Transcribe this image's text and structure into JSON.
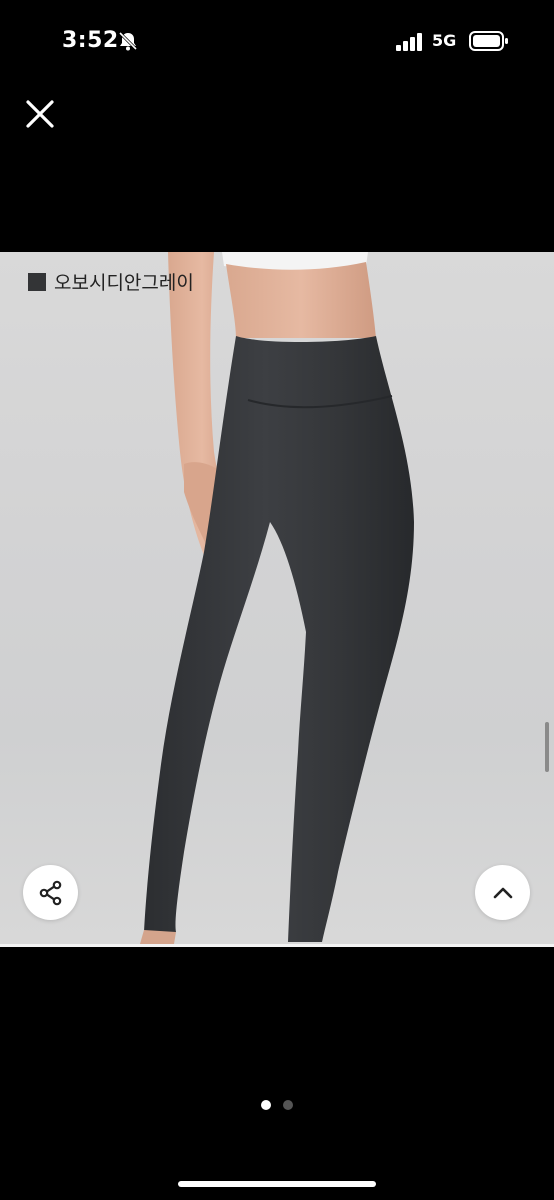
{
  "status_bar": {
    "time": "3:52",
    "network": "5G",
    "icons": [
      "bell-off-icon",
      "signal-icon",
      "battery-icon"
    ]
  },
  "viewer": {
    "close_icon": "close-icon",
    "color_label": "오보시디안그레이",
    "swatch_color": "#333436",
    "share_icon": "share-icon",
    "scroll_up_icon": "chevron-up-icon"
  },
  "pager": {
    "total": 2,
    "active_index": 0
  }
}
